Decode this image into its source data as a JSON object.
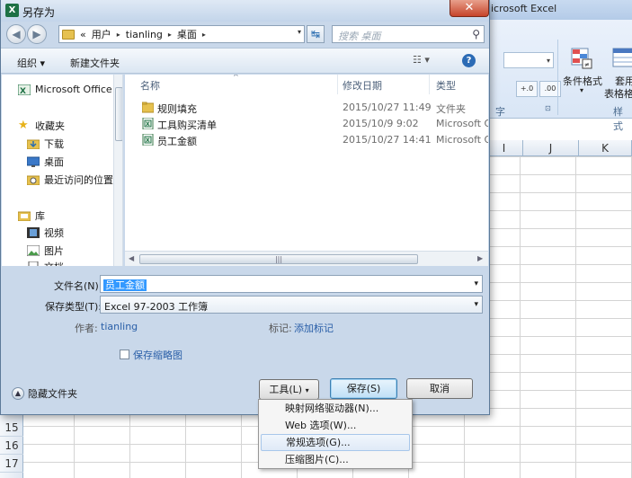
{
  "excel": {
    "title_fragment": "icrosoft Excel",
    "ribbon": {
      "conditional_format_label": "条件格式",
      "conditional_format_caret": "▾",
      "table_format_label_1": "套用",
      "table_format_label_2": "表格格",
      "number_group_label_fragment": "字",
      "styles_group_label_fragment": "样式",
      "dec_increase": "←.0 .00",
      "dec_decrease": ".00 →.0"
    },
    "columns": [
      "I",
      "J",
      "K"
    ],
    "rows": [
      "15",
      "16",
      "17"
    ]
  },
  "dialog": {
    "title": "另存为",
    "title_icon": "X",
    "close_glyph": "✕",
    "address": {
      "overflow": "«",
      "crumbs": [
        "用户",
        "tianling",
        "桌面"
      ],
      "sep": "▸",
      "dropdown": "▾"
    },
    "refresh_glyph": "↹",
    "search_placeholder": "搜索 桌面",
    "search_glyph": "⚲",
    "toolbar": {
      "organize": "组织 ▾",
      "new_folder": "新建文件夹",
      "view": "☷ ▾",
      "help": "?"
    },
    "nav": {
      "items": [
        {
          "label": "Microsoft Office"
        },
        {
          "label": "收藏夹"
        },
        {
          "label": "下载"
        },
        {
          "label": "桌面"
        },
        {
          "label": "最近访问的位置"
        },
        {
          "label": "库"
        },
        {
          "label": "视频"
        },
        {
          "label": "图片"
        },
        {
          "label": "文档"
        }
      ]
    },
    "files": {
      "headers": {
        "name": "名称",
        "modified": "修改日期",
        "type": "类型"
      },
      "rows": [
        {
          "name": "规则填充",
          "modified": "2015/10/27 11:49",
          "type": "文件夹",
          "icon": "folder"
        },
        {
          "name": "工具购买清单",
          "modified": "2015/10/9 9:02",
          "type": "Microsoft O",
          "icon": "excel"
        },
        {
          "name": "员工金额",
          "modified": "2015/10/27 14:41",
          "type": "Microsoft O",
          "icon": "excel"
        }
      ]
    },
    "form": {
      "filename_label": "文件名(N):",
      "filename_value": "员工金额",
      "savetype_label": "保存类型(T):",
      "savetype_value": "Excel 97-2003 工作簿",
      "author_label": "作者:",
      "author_value": "tianling",
      "tags_label": "标记:",
      "tags_value": "添加标记",
      "thumbnail_label": "保存缩略图"
    },
    "footer": {
      "hide_folders": "隐藏文件夹",
      "tools": "工具(L)",
      "save": "保存(S)",
      "cancel": "取消"
    },
    "tools_menu": [
      "映射网络驱动器(N)...",
      "Web 选项(W)...",
      "常规选项(G)...",
      "压缩图片(C)..."
    ]
  },
  "colors": {
    "dialog_bg": "#c9d8ea",
    "selection": "#3399ff",
    "link": "#2a5fa8",
    "excel_green": "#1e7145"
  }
}
